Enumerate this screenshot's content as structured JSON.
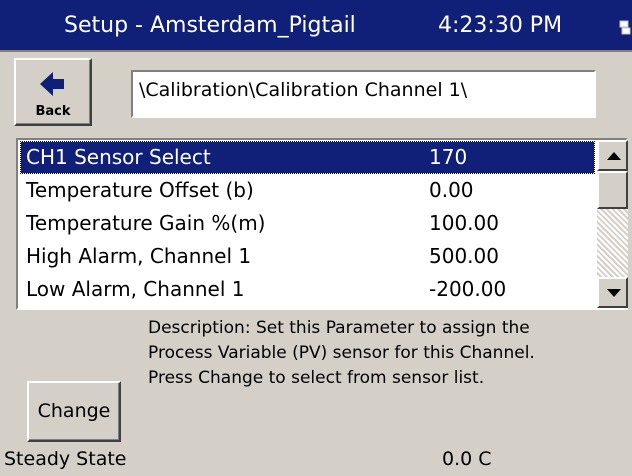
{
  "titlebar": {
    "title": "Setup - Amsterdam_Pigtail",
    "time": "4:23:30 PM",
    "icon": "network-icon"
  },
  "toolbar": {
    "back_label": "Back",
    "back_icon": "left-arrow-icon"
  },
  "path": "\\Calibration\\Calibration Channel 1\\",
  "parameters": [
    {
      "label": "CH1 Sensor Select",
      "value": "170",
      "selected": true
    },
    {
      "label": "Temperature Offset (b)",
      "value": "0.00"
    },
    {
      "label": "Temperature Gain %(m)",
      "value": "100.00"
    },
    {
      "label": "High Alarm, Channel 1",
      "value": "500.00"
    },
    {
      "label": "Low Alarm, Channel 1",
      "value": "-200.00"
    }
  ],
  "description": {
    "lines": [
      "Description:  Set this Parameter to assign the",
      "Process Variable (PV) sensor for this Channel.",
      "Press Change to select from sensor list."
    ]
  },
  "change_label": "Change",
  "status": {
    "label": "Steady State",
    "value": "0.0 C"
  },
  "colors": {
    "titlebar_bg": "#102078",
    "selection_bg": "#102078",
    "window_bg": "#d4d0c8"
  }
}
